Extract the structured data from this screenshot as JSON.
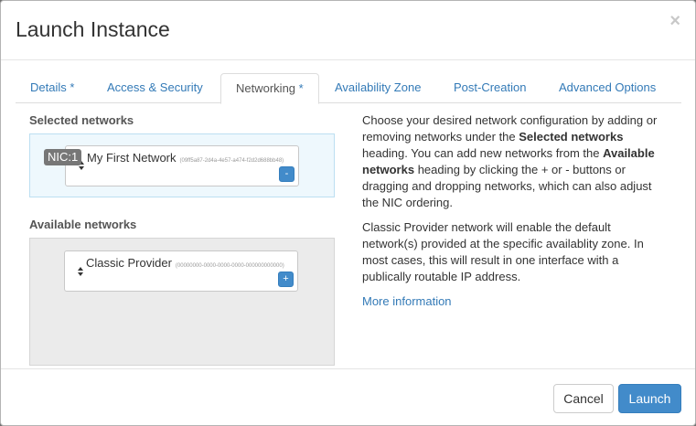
{
  "modal": {
    "title": "Launch Instance",
    "close": "×"
  },
  "tabs": [
    {
      "label": "Details",
      "required": "*"
    },
    {
      "label": "Access & Security",
      "required": ""
    },
    {
      "label": "Networking",
      "required": "*"
    },
    {
      "label": "Availability Zone",
      "required": ""
    },
    {
      "label": "Post-Creation",
      "required": ""
    },
    {
      "label": "Advanced Options",
      "required": ""
    }
  ],
  "active_tab": "Networking",
  "selected": {
    "label": "Selected networks",
    "nic_badge": "NIC:1",
    "network_name": "My First Network",
    "network_id": "(09ff5a87-2d4a-4e57-a474-f2d2d688bb48)",
    "button": "-"
  },
  "available": {
    "label": "Available networks",
    "network_name": "Classic Provider",
    "network_id": "(00000000-0000-0000-0000-000000000000)",
    "button": "+"
  },
  "help": {
    "p1_a": "Choose your desired network configuration by adding or removing networks under the ",
    "p1_b": "Selected networks",
    "p1_c": " heading. You can add new networks from the ",
    "p1_d": "Available networks",
    "p1_e": " heading by clicking the + or - buttons or dragging and dropping networks, which can also adjust the NIC ordering.",
    "p2": "Classic Provider network will enable the default network(s) provided at the specific availablity zone. In most cases, this will result in one interface with a publically routable IP address.",
    "more": "More information"
  },
  "footer": {
    "cancel": "Cancel",
    "launch": "Launch"
  },
  "colors": {
    "accent": "#428bca",
    "link": "#337ab7",
    "selected_bg": "#eef8fd",
    "available_bg": "#ebebeb"
  }
}
